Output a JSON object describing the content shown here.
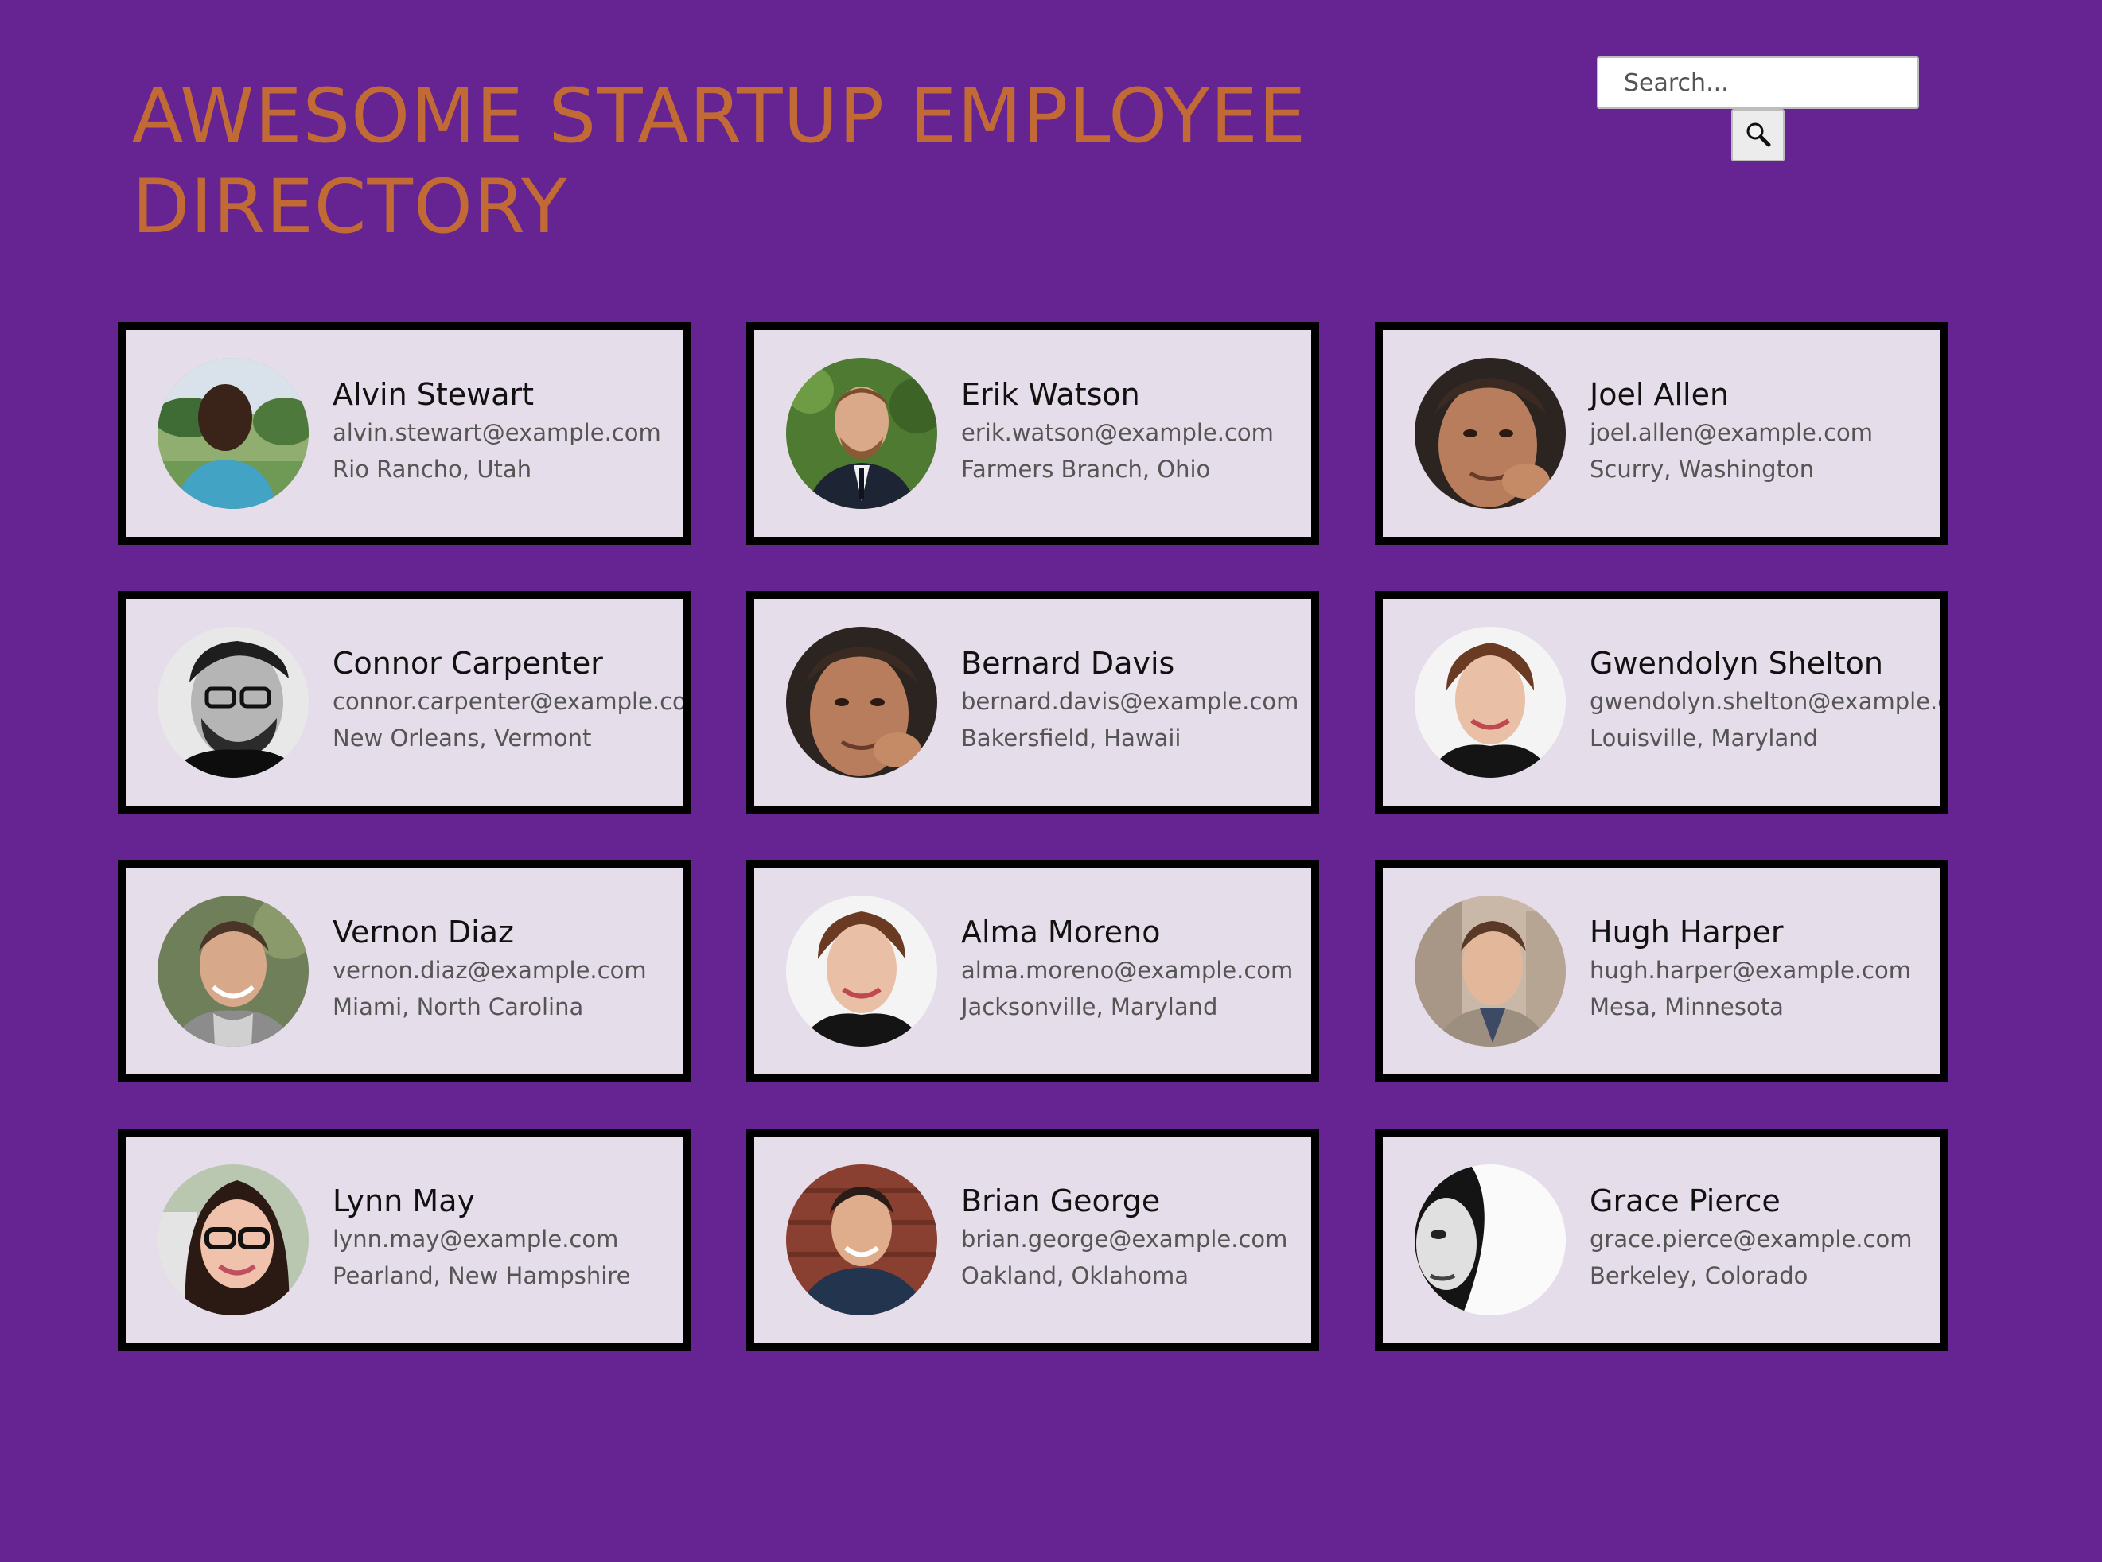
{
  "header": {
    "title": "AWESOME STARTUP EMPLOYEE DIRECTORY"
  },
  "search": {
    "placeholder": "Search...",
    "button_icon": "magnifying-glass-icon"
  },
  "employees": [
    {
      "name": "Alvin Stewart",
      "email": "alvin.stewart@example.com",
      "location": "Rio Rancho, Utah"
    },
    {
      "name": "Erik Watson",
      "email": "erik.watson@example.com",
      "location": "Farmers Branch, Ohio"
    },
    {
      "name": "Joel Allen",
      "email": "joel.allen@example.com",
      "location": "Scurry, Washington"
    },
    {
      "name": "Connor Carpenter",
      "email": "connor.carpenter@example.com",
      "location": "New Orleans, Vermont"
    },
    {
      "name": "Bernard Davis",
      "email": "bernard.davis@example.com",
      "location": "Bakersfield, Hawaii"
    },
    {
      "name": "Gwendolyn Shelton",
      "email": "gwendolyn.shelton@example.com",
      "location": "Louisville, Maryland"
    },
    {
      "name": "Vernon Diaz",
      "email": "vernon.diaz@example.com",
      "location": "Miami, North Carolina"
    },
    {
      "name": "Alma Moreno",
      "email": "alma.moreno@example.com",
      "location": "Jacksonville, Maryland"
    },
    {
      "name": "Hugh Harper",
      "email": "hugh.harper@example.com",
      "location": "Mesa, Minnesota"
    },
    {
      "name": "Lynn May",
      "email": "lynn.may@example.com",
      "location": "Pearland, New Hampshire"
    },
    {
      "name": "Brian George",
      "email": "brian.george@example.com",
      "location": "Oakland, Oklahoma"
    },
    {
      "name": "Grace Pierce",
      "email": "grace.pierce@example.com",
      "location": "Berkeley, Colorado"
    }
  ],
  "colors": {
    "background": "#652492",
    "title": "#C26A36",
    "card_background": "#E6DDEA",
    "card_border": "#000000"
  }
}
